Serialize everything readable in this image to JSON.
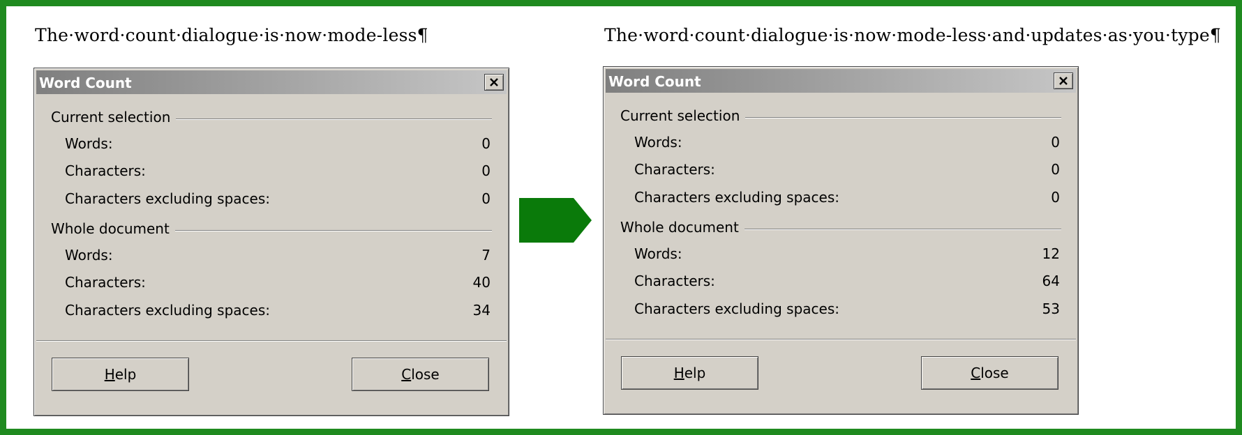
{
  "left": {
    "caption": "The·word·count·dialogue·is·now·mode-less¶",
    "dialog": {
      "title": "Word Count",
      "selection_group": "Current selection",
      "document_group": "Whole document",
      "selection": [
        {
          "label": "Words:",
          "value": "0"
        },
        {
          "label": "Characters:",
          "value": "0"
        },
        {
          "label": "Characters excluding spaces:",
          "value": "0"
        }
      ],
      "document": [
        {
          "label": "Words:",
          "value": "7"
        },
        {
          "label": "Characters:",
          "value": "40"
        },
        {
          "label": "Characters excluding spaces:",
          "value": "34"
        }
      ],
      "help_button": {
        "mnemonic": "H",
        "rest": "elp"
      },
      "close_button": {
        "mnemonic": "C",
        "rest": "lose"
      }
    }
  },
  "right": {
    "caption": "The·word·count·dialogue·is·now·mode-less·and·updates·as·you·type¶",
    "dialog": {
      "title": "Word Count",
      "selection_group": "Current selection",
      "document_group": "Whole document",
      "selection": [
        {
          "label": "Words:",
          "value": "0"
        },
        {
          "label": "Characters:",
          "value": "0"
        },
        {
          "label": "Characters excluding spaces:",
          "value": "0"
        }
      ],
      "document": [
        {
          "label": "Words:",
          "value": "12"
        },
        {
          "label": "Characters:",
          "value": "64"
        },
        {
          "label": "Characters excluding spaces:",
          "value": "53"
        }
      ],
      "help_button": {
        "mnemonic": "H",
        "rest": "elp"
      },
      "close_button": {
        "mnemonic": "C",
        "rest": "lose"
      }
    }
  },
  "colors": {
    "frame_border": "#1f8a1f",
    "arrow": "#0a7a0a",
    "dialog_face": "#d4d0c8"
  },
  "icons": {
    "arrow": "right-arrow-icon",
    "close": "close-icon"
  }
}
